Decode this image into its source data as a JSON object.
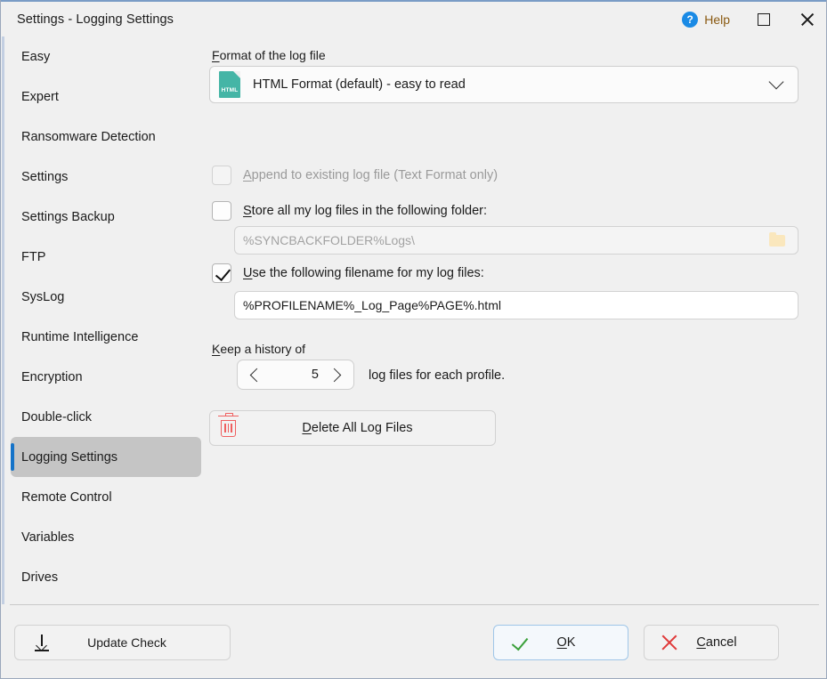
{
  "window": {
    "title": "Settings - Logging Settings",
    "help_label": "Help",
    "help_icon_glyph": "?",
    "maximize_icon": "maximize-icon",
    "close_icon": "close-icon",
    "accent_color": "#1573c8",
    "titlebar_top_border": "#7a9cc6"
  },
  "sidebar": {
    "items": [
      {
        "label": "Easy",
        "selected": false
      },
      {
        "label": "Expert",
        "selected": false
      },
      {
        "label": "Ransomware Detection",
        "selected": false
      },
      {
        "label": "Settings",
        "selected": false
      },
      {
        "label": "Settings Backup",
        "selected": false
      },
      {
        "label": "FTP",
        "selected": false
      },
      {
        "label": "SysLog",
        "selected": false
      },
      {
        "label": "Runtime Intelligence",
        "selected": false
      },
      {
        "label": "Encryption",
        "selected": false
      },
      {
        "label": "Double-click",
        "selected": false
      },
      {
        "label": "Logging Settings",
        "selected": true
      },
      {
        "label": "Remote Control",
        "selected": false
      },
      {
        "label": "Variables",
        "selected": false
      },
      {
        "label": "Drives",
        "selected": false
      }
    ],
    "selected_bg": "#c5c5c5"
  },
  "main": {
    "format": {
      "label_accel": "F",
      "label_rest": "ormat of the log file",
      "selected_value": "HTML Format (default) - easy to read",
      "icon_text": "HTML",
      "icon_color": "#45b5a6",
      "chevron": "chevron-down-icon"
    },
    "append_checkbox": {
      "checked": false,
      "enabled": false,
      "label_accel": "A",
      "label_rest": "ppend to existing log file (Text Format only)"
    },
    "store_folder_checkbox": {
      "checked": false,
      "enabled": true,
      "label_accel": "S",
      "label_rest": "tore all my log files in the following folder:"
    },
    "folder_input": {
      "value": "%SYNCBACKFOLDER%Logs\\",
      "enabled": false,
      "browse_icon": "folder-icon"
    },
    "filename_checkbox": {
      "checked": true,
      "enabled": true,
      "label_accel": "U",
      "label_rest": "se the following filename for my log files:"
    },
    "filename_input": {
      "value": "%PROFILENAME%_Log_Page%PAGE%.html",
      "enabled": true
    },
    "history": {
      "label_accel": "K",
      "label_rest": "eep a history of",
      "value": "5",
      "suffix": "log files for each profile.",
      "decrement_icon": "chevron-left-icon",
      "increment_icon": "chevron-right-icon"
    },
    "delete_button": {
      "label_accel": "D",
      "label_rest": "elete All Log Files",
      "icon": "trash-icon",
      "icon_color": "#ef5f5f"
    }
  },
  "footer": {
    "update_check": {
      "label": "Update Check",
      "icon": "download-arrow-icon"
    },
    "ok": {
      "label_accel": "O",
      "label_rest": "K",
      "icon": "checkmark-icon",
      "icon_color": "#3aa03a"
    },
    "cancel": {
      "label_accel": "C",
      "label_rest": "ancel",
      "icon": "x-icon",
      "icon_color": "#e03a3a"
    }
  }
}
